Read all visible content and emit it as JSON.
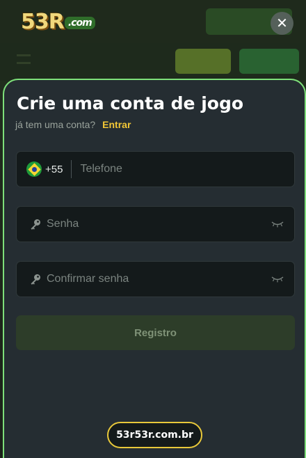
{
  "brand": {
    "logo_main": "53R",
    "logo_suffix": ".com"
  },
  "header": {
    "close_symbol": "✕"
  },
  "modal": {
    "title": "Crie uma conta de jogo",
    "subtitle": "já tem uma conta?",
    "login_link": "Entrar",
    "phone": {
      "country_flag": "brazil-flag-icon",
      "country_code": "+55",
      "placeholder": "Telefone",
      "value": ""
    },
    "password": {
      "placeholder": "Senha",
      "value": "",
      "icon": "key-icon",
      "toggle_icon": "eye-closed-icon"
    },
    "confirm_password": {
      "placeholder": "Confirmar senha",
      "value": "",
      "icon": "key-icon",
      "toggle_icon": "eye-closed-icon"
    },
    "submit_label": "Registro",
    "domain": "53r53r.com.br"
  },
  "colors": {
    "accent_green": "#7ee07a",
    "link_yellow": "#f2c736",
    "sheet_bg": "#252d32",
    "field_bg": "#141a1b",
    "submit_bg": "#2d3d29"
  }
}
